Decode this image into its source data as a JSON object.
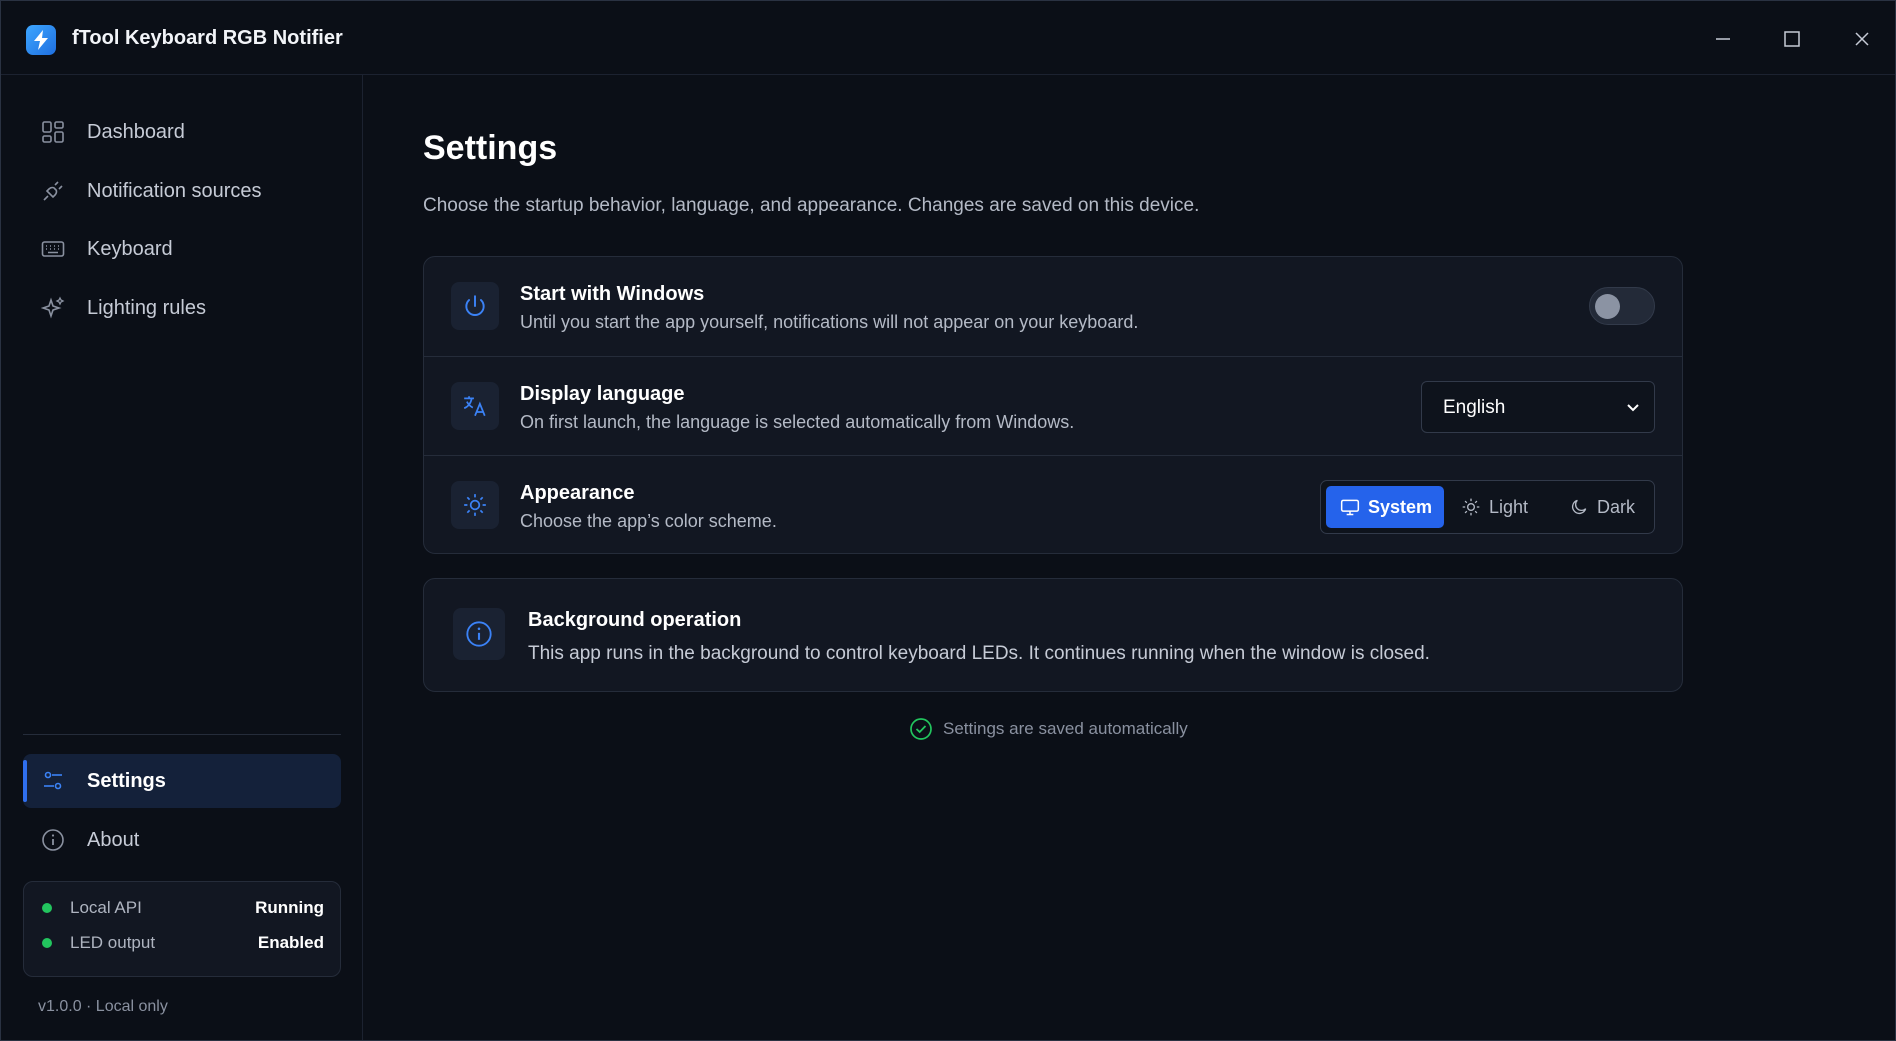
{
  "window": {
    "title": "fTool Keyboard RGB Notifier",
    "accent": "#2563eb"
  },
  "sidebar": {
    "items": [
      {
        "label": "Dashboard",
        "icon": "dashboard-icon"
      },
      {
        "label": "Notification sources",
        "icon": "plug-icon"
      },
      {
        "label": "Keyboard",
        "icon": "keyboard-icon"
      },
      {
        "label": "Lighting rules",
        "icon": "sparkles-icon"
      }
    ],
    "bottom_items": [
      {
        "label": "Settings",
        "icon": "sliders-icon",
        "active": true
      },
      {
        "label": "About",
        "icon": "info-icon",
        "active": false
      }
    ],
    "status": [
      {
        "name": "Local API",
        "value": "Running",
        "color": "#22c55e"
      },
      {
        "name": "LED output",
        "value": "Enabled",
        "color": "#22c55e"
      }
    ],
    "version": "v1.0.0 · Local only"
  },
  "main": {
    "title": "Settings",
    "description": "Choose the startup behavior, language, and appearance. Changes are saved on this device.",
    "settings": {
      "startup": {
        "title": "Start with Windows",
        "subtitle": "Until you start the app yourself, notifications will not appear on your keyboard.",
        "enabled": false
      },
      "language": {
        "title": "Display language",
        "subtitle": "On first launch, the language is selected automatically from Windows.",
        "selected": "English"
      },
      "appearance": {
        "title": "Appearance",
        "subtitle": "Choose the app’s color scheme.",
        "options": [
          "System",
          "Light",
          "Dark"
        ],
        "selected": "System"
      }
    },
    "info": {
      "title": "Background operation",
      "text": "This app runs in the background to control keyboard LEDs. It continues running when the window is closed."
    },
    "saved_note": "Settings are saved automatically"
  }
}
